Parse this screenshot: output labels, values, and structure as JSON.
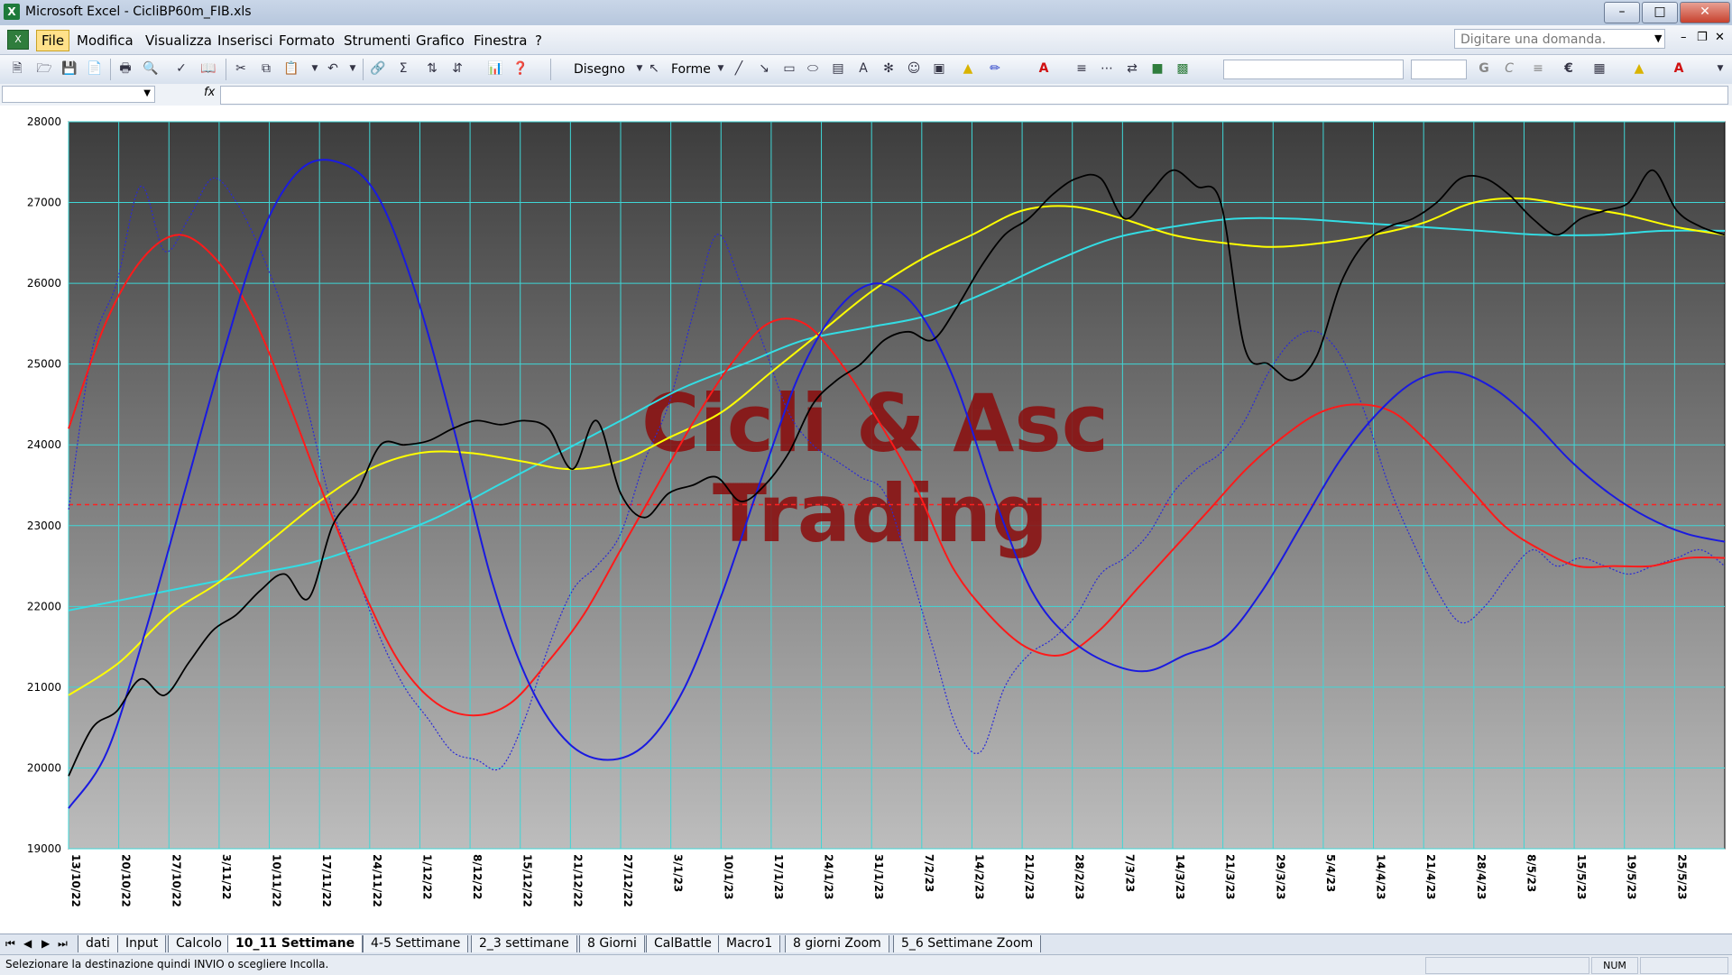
{
  "window": {
    "title": "Microsoft Excel - CicliBP60m_FIB.xls",
    "app_icon": "X"
  },
  "menu": {
    "items": [
      "File",
      "Modifica",
      "Visualizza",
      "Inserisci",
      "Formato",
      "Strumenti",
      "Grafico",
      "Finestra",
      "?"
    ],
    "active": "File",
    "help_placeholder": "Digitare una domanda."
  },
  "toolbar": {
    "draw_label": "Disegno",
    "shapes_label": "Forme",
    "bold": "G",
    "italic": "C",
    "euro": "€",
    "sum": "Σ"
  },
  "formula": {
    "fx": "fx"
  },
  "chart_data": {
    "type": "line",
    "ylim": [
      19000,
      28000
    ],
    "yticks": [
      19000,
      20000,
      21000,
      22000,
      23000,
      24000,
      25000,
      26000,
      27000,
      28000
    ],
    "x_labels": [
      "13/10/22",
      "20/10/22",
      "27/10/22",
      "3/11/22",
      "10/11/22",
      "17/11/22",
      "24/11/22",
      "1/12/22",
      "8/12/22",
      "15/12/22",
      "21/12/22",
      "27/12/22",
      "3/1/23",
      "10/1/23",
      "17/1/23",
      "24/1/23",
      "31/1/23",
      "7/2/23",
      "14/2/23",
      "21/2/23",
      "28/2/23",
      "7/3/23",
      "14/3/23",
      "21/3/23",
      "29/3/23",
      "5/4/23",
      "14/4/23",
      "21/4/23",
      "28/4/23",
      "8/5/23",
      "15/5/23",
      "19/5/23",
      "25/5/23"
    ],
    "grid": true,
    "reference_line": {
      "value": 23260,
      "color": "#ff2020",
      "style": "dashed"
    },
    "watermark": [
      "Cicli & Asc",
      "Trading"
    ],
    "series": [
      {
        "color": "#000000",
        "style": "solid",
        "values": [
          19900,
          20500,
          20700,
          21100,
          20900,
          21300,
          21700,
          21900,
          22200,
          22400,
          22100,
          23000,
          23400,
          24000,
          24000,
          24050,
          24200,
          24300,
          24250,
          24300,
          24200,
          23700,
          24300,
          23400,
          23100,
          23400,
          23500,
          23600,
          23300,
          23500,
          23900,
          24500,
          24800,
          25000,
          25300,
          25400,
          25300,
          25700,
          26200,
          26600,
          26800,
          27100,
          27300,
          27300,
          26800,
          27100,
          27400,
          27200,
          27000,
          25200,
          25000,
          24800,
          25100,
          26000,
          26500,
          26700,
          26800,
          27000,
          27300,
          27300,
          27100,
          26800,
          26600,
          26800,
          26900,
          27000,
          27400,
          26900,
          26700,
          26600
        ]
      },
      {
        "color": "#2a2ad8",
        "style": "dotted",
        "values": [
          23200,
          25200,
          26000,
          27200,
          26400,
          26800,
          27300,
          27000,
          26400,
          25600,
          24400,
          23200,
          22400,
          21600,
          21000,
          20600,
          20200,
          20100,
          20000,
          20600,
          21500,
          22200,
          22500,
          22900,
          23800,
          24500,
          25600,
          26600,
          26000,
          25200,
          24400,
          24000,
          23800,
          23600,
          23400,
          22500,
          21500,
          20500,
          20200,
          21000,
          21400,
          21600,
          21900,
          22400,
          22600,
          22900,
          23400,
          23700,
          23900,
          24300,
          24900,
          25300,
          25400,
          25100,
          24400,
          23500,
          22800,
          22200,
          21800,
          22000,
          22400,
          22700,
          22500,
          22600,
          22500,
          22400,
          22500,
          22600,
          22700,
          22500
        ]
      },
      {
        "color": "#ff1a1a",
        "style": "solid",
        "values": [
          24200,
          25500,
          26300,
          26600,
          26300,
          25600,
          24500,
          23300,
          22200,
          21300,
          20800,
          20650,
          20800,
          21300,
          21900,
          22700,
          23500,
          24300,
          25000,
          25500,
          25500,
          25000,
          24300,
          23500,
          22500,
          21900,
          21500,
          21400,
          21700,
          22200,
          22700,
          23200,
          23700,
          24100,
          24400,
          24500,
          24400,
          24000,
          23500,
          23000,
          22700,
          22500,
          22500,
          22500,
          22600,
          22600
        ]
      },
      {
        "color": "#1a1ae0",
        "style": "solid",
        "values": [
          19500,
          20200,
          21700,
          23400,
          25100,
          26600,
          27400,
          27500,
          27100,
          25900,
          24200,
          22300,
          21000,
          20300,
          20100,
          20300,
          21000,
          22200,
          23600,
          24900,
          25700,
          26000,
          25700,
          24800,
          23400,
          22200,
          21600,
          21300,
          21200,
          21400,
          21600,
          22200,
          23000,
          23800,
          24400,
          24800,
          24900,
          24700,
          24300,
          23800,
          23400,
          23100,
          22900,
          22800
        ]
      },
      {
        "color": "#ffff00",
        "style": "solid",
        "values": [
          20900,
          21300,
          21900,
          22300,
          22800,
          23300,
          23700,
          23900,
          23900,
          23800,
          23700,
          23800,
          24100,
          24400,
          24900,
          25400,
          25900,
          26300,
          26600,
          26900,
          26950,
          26800,
          26600,
          26500,
          26450,
          26500,
          26600,
          26750,
          27000,
          27050,
          26950,
          26850,
          26700,
          26600
        ]
      },
      {
        "color": "#33dde4",
        "style": "solid",
        "values": [
          21950,
          22100,
          22250,
          22400,
          22550,
          22800,
          23100,
          23500,
          23900,
          24300,
          24700,
          25000,
          25300,
          25450,
          25600,
          25900,
          26250,
          26550,
          26700,
          26800,
          26800,
          26750,
          26700,
          26650,
          26600,
          26600,
          26650,
          26650
        ]
      }
    ]
  },
  "sheets": {
    "tabs": [
      "dati",
      "Input",
      "Calcolo",
      "10_11 Settimane",
      "4-5 Settimane",
      "2_3 settimane",
      "8 Giorni",
      "CalBattle",
      "Macro1",
      "8 giorni Zoom",
      "5_6 Settimane Zoom"
    ],
    "active": "10_11 Settimane"
  },
  "status": {
    "message": "Selezionare la destinazione quindi INVIO o scegliere Incolla.",
    "num": "NUM"
  }
}
